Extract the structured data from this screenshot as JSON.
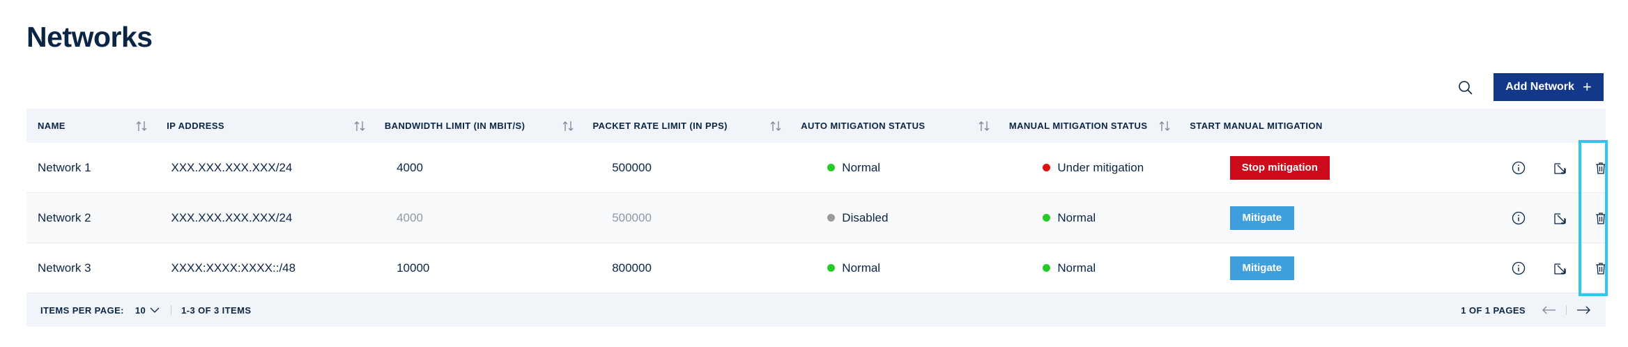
{
  "page": {
    "title": "Networks"
  },
  "toolbar": {
    "search_icon": "search-icon",
    "add_label": "Add Network",
    "add_icon": "+"
  },
  "table": {
    "columns": [
      "Name",
      "IP Address",
      "Bandwidth Limit (in Mbit/s)",
      "Packet Rate Limit (in PPS)",
      "Auto Mitigation Status",
      "Manual Mitigation Status",
      "Start Manual Mitigation"
    ],
    "rows": [
      {
        "name": "Network 1",
        "ip": "XXX.XXX.XXX.XXX/24",
        "bandwidth": "4000",
        "packet_rate": "500000",
        "auto_status": "Normal",
        "manual_status": "Under mitigation",
        "action": "Stop mitigation"
      },
      {
        "name": "Network 2",
        "ip": "XXX.XXX.XXX.XXX/24",
        "bandwidth": "4000",
        "packet_rate": "500000",
        "auto_status": "Disabled",
        "manual_status": "Normal",
        "action": "Mitigate"
      },
      {
        "name": "Network 3",
        "ip": "XXXX:XXXX:XXXX::/48",
        "bandwidth": "10000",
        "packet_rate": "800000",
        "auto_status": "Normal",
        "manual_status": "Normal",
        "action": "Mitigate"
      }
    ]
  },
  "footer": {
    "items_per_page_label": "Items per page:",
    "items_per_page_value": "10",
    "range": "1-3 of 3 items",
    "pages": "1 of 1 pages"
  },
  "colors": {
    "brand": "#13388a",
    "status_normal": "#22cc22",
    "status_disabled": "#9a9a9a",
    "status_mitigating": "#dd1111",
    "stop_button": "#cc0a1b",
    "mitigate_button": "#3e9fdc",
    "highlight": "#30c6ef"
  }
}
